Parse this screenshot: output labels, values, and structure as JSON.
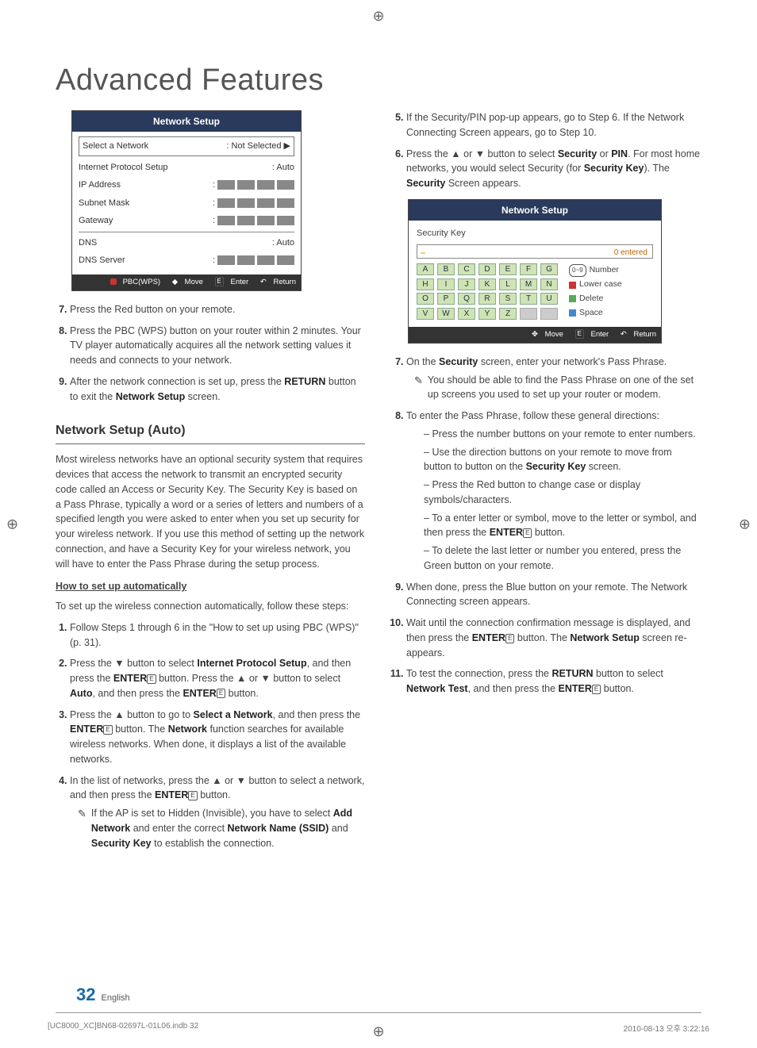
{
  "title": "Advanced Features",
  "osd1": {
    "title": "Network Setup",
    "rows": {
      "select_net": "Select a Network",
      "select_net_val": ": Not Selected  ▶",
      "ips": "Internet Protocol Setup",
      "ips_val": ": Auto",
      "ip": "IP Address",
      "subnet": "Subnet Mask",
      "gateway": "Gateway",
      "dns": "DNS",
      "dns_val": ": Auto",
      "dns_server": "DNS Server"
    },
    "footer": {
      "a": "PBC(WPS)",
      "move": "Move",
      "enter": "Enter",
      "ret": "Return"
    }
  },
  "left_steps_a": {
    "s7": "Press the Red button on your remote.",
    "s8": "Press the PBC (WPS) button on your router within 2 minutes. Your TV player automatically acquires all the network setting values it needs and connects to your network.",
    "s9_a": "After the network connection is set up, press the ",
    "s9_return": "RETURN",
    "s9_b": " button to exit the ",
    "s9_ns": "Network Setup",
    "s9_c": " screen."
  },
  "section_heading": "Network Setup (Auto)",
  "auto_para": "Most wireless networks have an optional security system that requires devices that access the network to transmit an encrypted security code called an Access or Security Key. The Security Key is based on a Pass Phrase, typically a word or a series of letters and numbers of a specified length you were asked to enter when you set up security for your wireless network.  If you use this method of setting up the network connection, and have a Security Key for your wireless network, you will have to enter the Pass Phrase during the setup process.",
  "howto": "How to set up automatically",
  "auto_intro": "To set up the wireless connection automatically, follow these steps:",
  "left_steps_b": {
    "s1": "Follow Steps 1 through 6 in the \"How to set up using PBC (WPS)\" (p. 31).",
    "s2_a": "Press the ▼ button to select ",
    "s2_b": "Internet Protocol Setup",
    "s2_c": ", and then press the ",
    "s2_enter": "ENTER",
    "s2_d": " button. Press the ▲ or ▼ button to select ",
    "s2_auto": "Auto",
    "s2_e": ", and then press the ",
    "s2_f": " button.",
    "s3_a": "Press the ▲ button to go to ",
    "s3_b": "Select a Network",
    "s3_c": ", and then press the ",
    "s3_d": " button. The ",
    "s3_net": "Network",
    "s3_e": " function searches for available wireless networks. When done, it displays a list of the available networks.",
    "s4_a": "In the list of networks, press the ▲ or ▼ button to select a network, and then press the ",
    "s4_b": " button.",
    "s4_note_a": "If the AP is set to Hidden (Invisible), you have to select ",
    "s4_addnet": "Add Network",
    "s4_note_b": " and enter the correct ",
    "s4_ssid": "Network Name (SSID)",
    "s4_note_c": " and ",
    "s4_sk": "Security Key",
    "s4_note_d": " to establish the connection."
  },
  "right_top": {
    "s5_a": "If the Security/PIN pop-up appears, go to Step 6. If the Network Connecting Screen appears, go to Step 10.",
    "s6_a": "Press the ▲ or ▼ button to select ",
    "s6_sec": "Security",
    "s6_b": " or ",
    "s6_pin": "PIN",
    "s6_c": ". For most home networks, you would select Security (for ",
    "s6_sk": "Security Key",
    "s6_d": "). The ",
    "s6_sec2": "Security",
    "s6_e": " Screen appears."
  },
  "osd2": {
    "title": "Network Setup",
    "sec_key": "Security Key",
    "entered": "0 entered",
    "keys": [
      "A",
      "B",
      "C",
      "D",
      "E",
      "F",
      "G",
      "H",
      "I",
      "J",
      "K",
      "L",
      "M",
      "N",
      "O",
      "P",
      "Q",
      "R",
      "S",
      "T",
      "U",
      "V",
      "W",
      "X",
      "Y",
      "Z",
      "",
      ""
    ],
    "ops": {
      "number": "Number",
      "lower": "Lower case",
      "delete": "Delete",
      "space": "Space"
    },
    "footer": {
      "move": "Move",
      "enter": "Enter",
      "ret": "Return"
    }
  },
  "right_steps": {
    "s7_a": "On the ",
    "s7_sec": "Security",
    "s7_b": " screen, enter your network's Pass Phrase.",
    "s7_note": "You should be able to find the Pass Phrase on one of the set up screens you used to set up your router or modem.",
    "s8": "To enter the Pass Phrase, follow these general directions:",
    "d1": "Press the number buttons on your remote to enter numbers.",
    "d2_a": "Use the direction buttons on your remote to move from button to button on the ",
    "d2_b": "Security Key",
    "d2_c": " screen.",
    "d3": "Press the Red button to change case or display symbols/characters.",
    "d4_a": "To a enter letter or symbol, move to the letter or symbol, and then press the ",
    "d4_b": " button.",
    "d5": "To delete the last letter or number you entered, press the Green button on your remote.",
    "s9": "When done, press the Blue button on your remote. The Network Connecting screen appears.",
    "s10_a": "Wait until the connection confirmation message is displayed, and then press the ",
    "s10_b": " button. The ",
    "s10_ns": "Network Setup",
    "s10_c": " screen re-appears.",
    "s11_a": "To test the connection, press the ",
    "s11_ret": "RETURN",
    "s11_b": " button to select ",
    "s11_nt": "Network Test",
    "s11_c": ", and then press the ",
    "s11_d": " button."
  },
  "glyphs": {
    "enter": "E",
    "note": "✎",
    "move": "✥",
    "ret": "↶",
    "updown": "◆"
  },
  "footer": {
    "pagenum": "32",
    "lang": "English",
    "file": "[UC8000_XC]BN68-02697L-01L06.indb   32",
    "ts": "2010-08-13   오후 3:22:16"
  }
}
